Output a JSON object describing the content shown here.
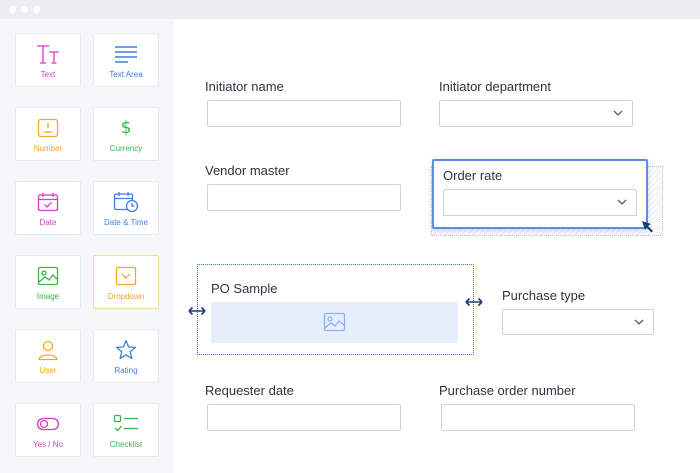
{
  "palette": {
    "items": [
      {
        "label": "Text",
        "icon": "text-icon",
        "color": "#d63cc2"
      },
      {
        "label": "Text Area",
        "icon": "text-area-icon",
        "color": "#3f7fe0"
      },
      {
        "label": "Number",
        "icon": "number-icon",
        "color": "#f5a623"
      },
      {
        "label": "Currency",
        "icon": "currency-icon",
        "color": "#3cb44b"
      },
      {
        "label": "Date",
        "icon": "date-icon",
        "color": "#d63cc2"
      },
      {
        "label": "Date & Time",
        "icon": "date-time-icon",
        "color": "#3f7fe0"
      },
      {
        "label": "Image",
        "icon": "image-icon",
        "color": "#3cb44b"
      },
      {
        "label": "Dropdown",
        "icon": "dropdown-icon",
        "color": "#f5a623"
      },
      {
        "label": "User",
        "icon": "user-icon",
        "color": "#f5a623"
      },
      {
        "label": "Rating",
        "icon": "rating-icon",
        "color": "#3f7fe0"
      },
      {
        "label": "Yes / No",
        "icon": "toggle-icon",
        "color": "#d63cc2"
      },
      {
        "label": "Checklist",
        "icon": "checklist-icon",
        "color": "#3cb44b"
      }
    ]
  },
  "form": {
    "initiator_name": {
      "label": "Initiator name",
      "value": ""
    },
    "initiator_department": {
      "label": "Initiator department",
      "value": ""
    },
    "vendor_master": {
      "label": "Vendor master",
      "value": ""
    },
    "order_rate": {
      "label": "Order rate",
      "value": ""
    },
    "po_sample": {
      "label": "PO Sample"
    },
    "purchase_type": {
      "label": "Purchase type",
      "value": ""
    },
    "requester_date": {
      "label": "Requester date",
      "value": ""
    },
    "purchase_order_number": {
      "label": "Purchase order number",
      "value": ""
    }
  },
  "colors": {
    "accent": "#3f6fd0",
    "selection": "#5b8de8",
    "image_placeholder": "#e6eefc"
  }
}
